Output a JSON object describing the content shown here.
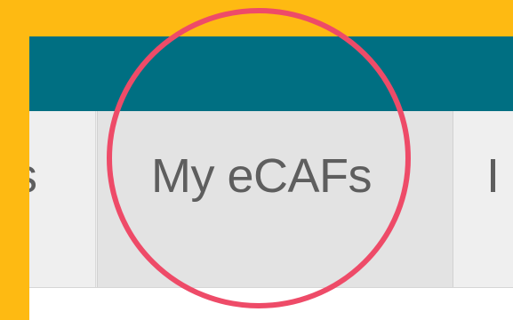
{
  "colors": {
    "page_background": "#FEBA12",
    "header_background": "#006F82",
    "tab_background": "#EFEFEF",
    "active_tab_background": "#E3E3E3",
    "tab_text": "#5E5E5E",
    "highlight_ring": "#EE4B68"
  },
  "tabs": [
    {
      "label": "s"
    },
    {
      "label": "My eCAFs"
    },
    {
      "label": "I"
    }
  ],
  "annotation": {
    "type": "highlight-circle",
    "target": "tab-my-ecafs"
  }
}
